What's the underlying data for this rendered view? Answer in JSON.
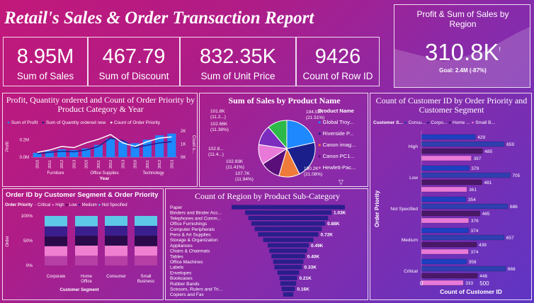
{
  "report_title": "Retail's Sales & Order Transaction Report",
  "kpis": [
    {
      "value": "8.95M",
      "label": "Sum of Sales"
    },
    {
      "value": "467.79",
      "label": "Sum of Discount"
    },
    {
      "value": "832.35K",
      "label": "Sum of Unit Price"
    },
    {
      "value": "9426",
      "label": "Count of Row ID"
    }
  ],
  "region_kpi": {
    "title": "Profit & Sum of Sales by Region",
    "value": "310.8K",
    "mark": "!",
    "goal": "Goal: 2.4M (-87%)"
  },
  "colors": {
    "accent_blue": "#1e88ff",
    "navy": "#1a1f8c",
    "pink": "#e879d8",
    "white": "#ffffff"
  },
  "chart_data": [
    {
      "type": "bar",
      "title": "Profit, Quantity ordered and Count of Order Priority by Product Category & Year",
      "legend": [
        "Sum of Profit",
        "Sum of Quantity ordered new",
        "Count of Order Priority"
      ],
      "xlabel": "Year",
      "ylabel_left": "Profit",
      "ylabel_right": "Count o...",
      "yticks_left": [
        "0.0M",
        "0.2M"
      ],
      "yticks_right": [
        "0K",
        "1K",
        "2K"
      ],
      "groups": [
        {
          "name": "Furniture",
          "years": [
            "2010",
            "2011",
            "2012",
            "2013"
          ]
        },
        {
          "name": "Office Supplies",
          "years": [
            "2010",
            "2011",
            "2012",
            "2013"
          ]
        },
        {
          "name": "Technology",
          "years": [
            "2010",
            "2011",
            "2012",
            "2013"
          ]
        }
      ],
      "series": [
        {
          "name": "Sum of Profit",
          "values": [
            0.05,
            0.07,
            0.09,
            0.08,
            0.1,
            0.14,
            0.21,
            0.18,
            0.16,
            0.2,
            0.25,
            0.27
          ]
        },
        {
          "name": "Sum of Quantity ordered new",
          "values": [
            0.3,
            0.4,
            0.5,
            0.45,
            0.6,
            0.9,
            1.6,
            1.4,
            0.8,
            1.0,
            1.2,
            1.3
          ]
        },
        {
          "name": "Count of Order Priority",
          "values": [
            0.4,
            0.6,
            0.9,
            0.8,
            1.2,
            1.5,
            1.9,
            1.2,
            0.9,
            1.3,
            1.6,
            1.7
          ]
        }
      ]
    },
    {
      "type": "pie",
      "title": "Sum of Sales by Product Name",
      "legend_title": "Product Name",
      "slices": [
        {
          "name": "Global Troy...",
          "value": 194.03,
          "label": "194.03K (21.51%)",
          "color": "#1e88ff"
        },
        {
          "name": "Riverside P...",
          "value": 190.2,
          "label": "190.2K (21.08%)",
          "color": "#1a1f8c"
        },
        {
          "name": "Canon imag...",
          "value": 107.7,
          "label": "107.7K (11.94%)",
          "color": "#ef7b3b"
        },
        {
          "name": "Canon PC1...",
          "value": 102.93,
          "label": "102.93K (11.41%)",
          "color": "#5a0e7a"
        },
        {
          "name": "Hewlett-Pac...",
          "value": 102.8,
          "label": "102.8... (11.4...)",
          "color": "#e879d8"
        },
        {
          "name": "",
          "value": 102.66,
          "label": "102.66K (11.38%)",
          "color": "#7b2cbf"
        },
        {
          "name": "",
          "value": 101.8,
          "label": "101.8K (11.2...)",
          "color": "#2db84a"
        }
      ]
    },
    {
      "type": "bar",
      "title": "Count of Customer ID by Order Priority and Customer Segment",
      "legend_title": "Customer S...",
      "legend": [
        "Consu...",
        "Corpo...",
        "Home ...",
        "Small B..."
      ],
      "ylabel": "Order Priority",
      "xlabel": "Count of Customer ID",
      "xticks": [
        "0",
        "500"
      ],
      "categories": [
        "High",
        "Low",
        "Not Specified",
        "Medium",
        "Critical"
      ],
      "series": [
        {
          "name": "Consu...",
          "values": [
            429,
            379,
            354,
            374,
            358
          ]
        },
        {
          "name": "Corpo...",
          "values": [
            659,
            705,
            686,
            657,
            668
          ]
        },
        {
          "name": "Home ...",
          "values": [
            485,
            481,
            465,
            439,
            446
          ]
        },
        {
          "name": "Small B...",
          "values": [
            397,
            361,
            376,
            374,
            333
          ]
        }
      ]
    },
    {
      "type": "bar",
      "title": "Order ID by Customer Segment & Order Priority",
      "legend_title": "Order Priority",
      "legend": [
        "Critical",
        "High",
        "Low",
        "Medium",
        "Not Specified"
      ],
      "ylabel": "Order",
      "xlabel": "Customer Segment",
      "yticks": [
        "0%",
        "50%",
        "100%"
      ],
      "categories": [
        "Corporate",
        "Home Office",
        "Consumer",
        "Small Business"
      ],
      "series": [
        {
          "name": "Critical",
          "values": [
            0.19,
            0.2,
            0.19,
            0.2
          ]
        },
        {
          "name": "High",
          "values": [
            0.2,
            0.2,
            0.21,
            0.19
          ]
        },
        {
          "name": "Low",
          "values": [
            0.2,
            0.2,
            0.2,
            0.21
          ]
        },
        {
          "name": "Medium",
          "values": [
            0.2,
            0.19,
            0.2,
            0.2
          ]
        },
        {
          "name": "Not Specified",
          "values": [
            0.21,
            0.21,
            0.2,
            0.2
          ]
        }
      ]
    },
    {
      "type": "bar",
      "title": "Count of Region by Product Sub-Category",
      "categories": [
        "Paper",
        "Binders and Binder Acc...",
        "Telephones and Comm...",
        "Office Furnishings",
        "Computer Peripherals",
        "Pens & Art Supplies",
        "Storage & Organization",
        "Appliances",
        "Chairs & Chairmats",
        "Tables",
        "Office Machines",
        "Labels",
        "Envelopes",
        "Bookcases",
        "Rubber Bands",
        "Scissors, Rulers and Tri...",
        "Copiers and Fax"
      ],
      "values": [
        1.35,
        1.03,
        0.95,
        0.88,
        0.8,
        0.72,
        0.6,
        0.49,
        0.45,
        0.4,
        0.36,
        0.33,
        0.26,
        0.21,
        0.19,
        0.16,
        0.12
      ],
      "data_labels": {
        "1": "1.03K",
        "3": "0.88K",
        "5": "0.72K",
        "7": "0.49K",
        "9": "0.40K",
        "11": "0.33K",
        "13": "0.21K",
        "15": "0.16K"
      }
    }
  ]
}
